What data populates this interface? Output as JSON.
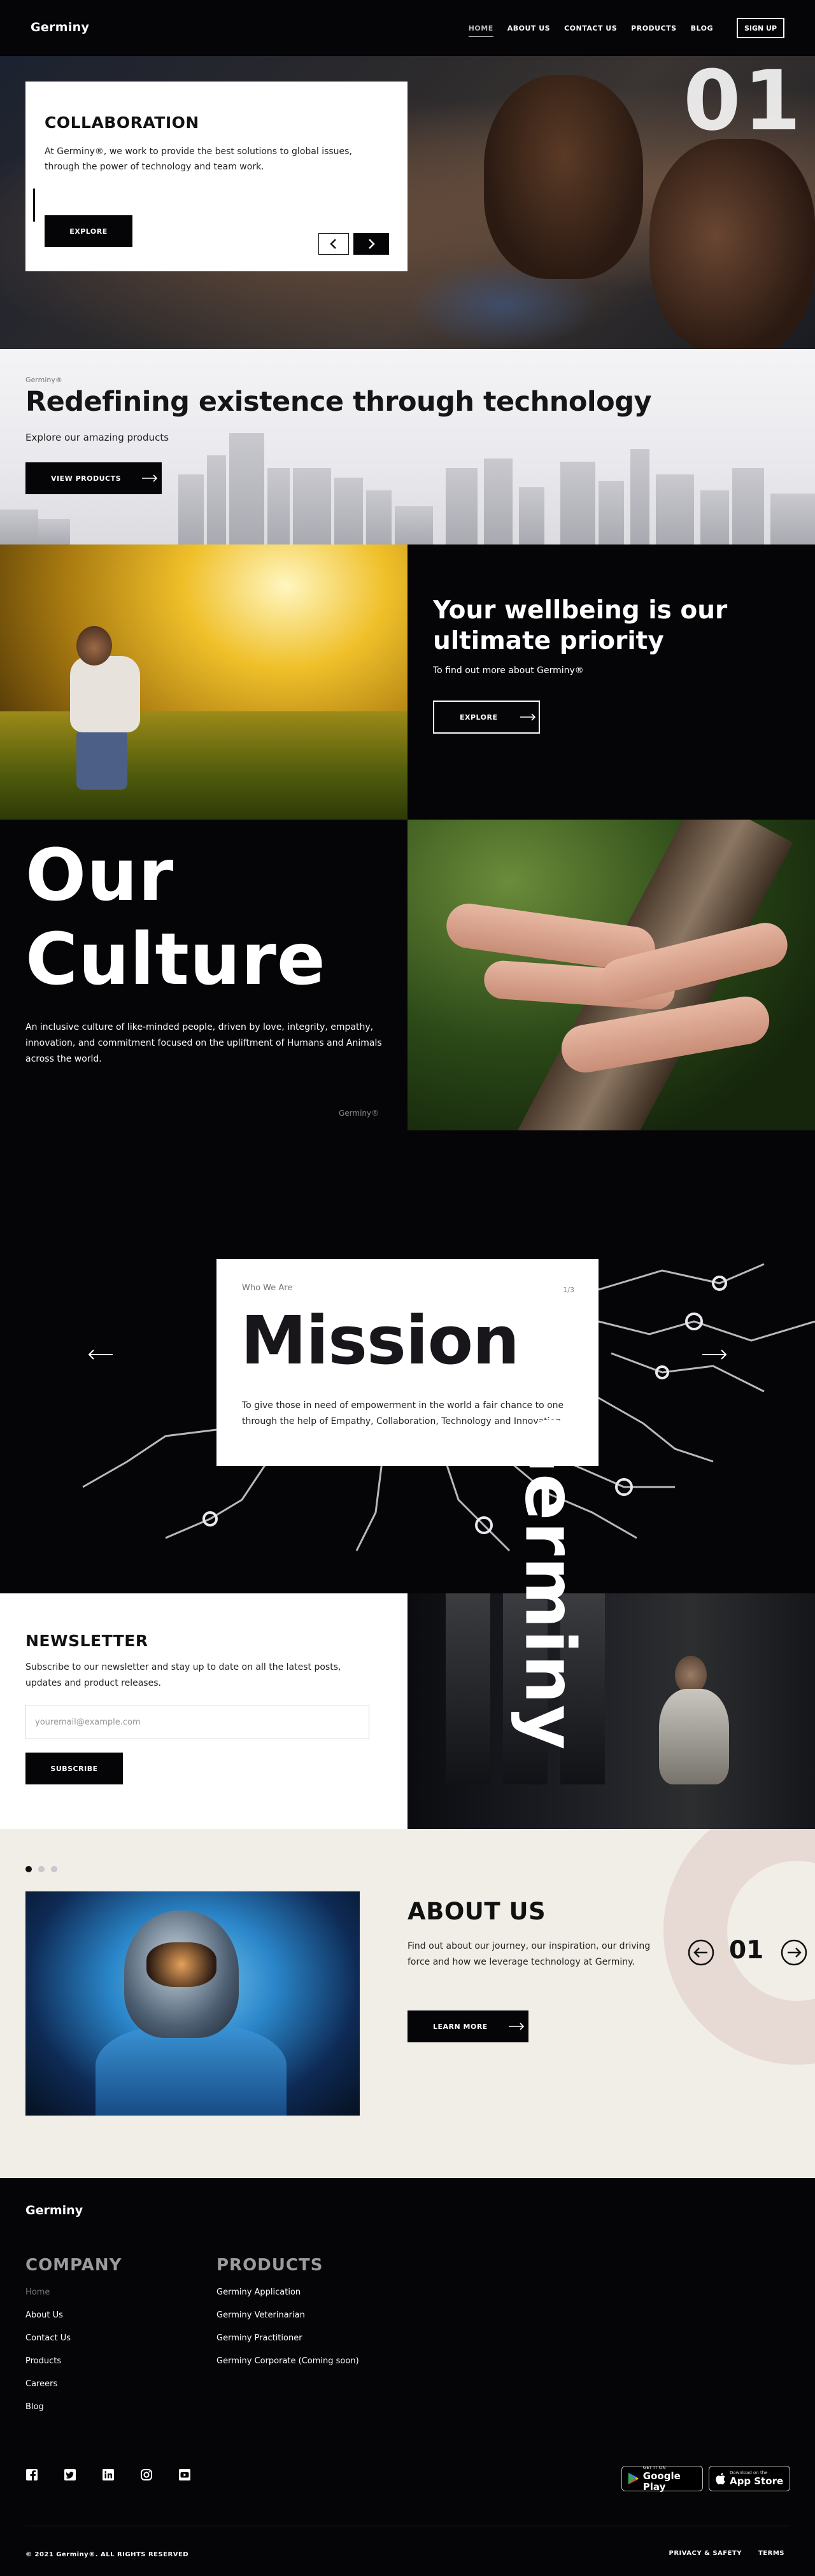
{
  "nav": {
    "logo": "Germiny",
    "items": [
      "HOME",
      "ABOUT US",
      "CONTACT US",
      "PRODUCTS",
      "BLOG"
    ],
    "signup": "SIGN UP"
  },
  "hero": {
    "slide_number": "01",
    "title": "COLLABORATION",
    "text": "At Germiny®, we work to provide the best solutions to global issues, through the power of technology and team work.",
    "button": "EXPLORE"
  },
  "redefining": {
    "tag": "Germiny®",
    "title": "Redefining existence through technology",
    "subtitle": "Explore our amazing products",
    "button": "VIEW PRODUCTS"
  },
  "wellbeing": {
    "title": "Your wellbeing is our ultimate priority",
    "subtitle": "To find out more about Germiny®",
    "button": "EXPLORE"
  },
  "culture": {
    "title_line1": "Our",
    "title_line2": "Culture",
    "text": "An inclusive culture of like-minded people, driven by love, integrity, empathy, innovation, and commitment focused on the upliftment of Humans and Animals across the world.",
    "brand": "Germiny®"
  },
  "mission": {
    "eyebrow": "Who We Are",
    "counter": "1/3",
    "title": "Mission",
    "text": "To give those in need of empowerment in the world a fair chance to one through the help of Empathy, Collaboration, Technology and Innovation."
  },
  "newsletter": {
    "title": "NEWSLETTER",
    "text": "Subscribe to our newsletter and stay up to date on all the latest posts, updates and product releases.",
    "placeholder": "youremail@example.com",
    "button": "SUBSCRIBE",
    "brand_vertical": "Germiny"
  },
  "about": {
    "title": "ABOUT US",
    "text": "Find out about our journey, our inspiration, our driving force and how we leverage technology at Germiny.",
    "button": "LEARN MORE",
    "slide_number": "01",
    "dots_total": 3,
    "dots_active": 1
  },
  "footer": {
    "logo": "Germiny",
    "company_heading": "COMPANY",
    "company_links": [
      "Home",
      "About Us",
      "Contact Us",
      "Products",
      "Careers",
      "Blog"
    ],
    "products_heading": "PRODUCTS",
    "product_links": [
      "Germiny Application",
      "Germiny Veterinarian",
      "Germiny Practitioner",
      "Germiny Corporate (Coming soon)"
    ],
    "social_icons": [
      "facebook-icon",
      "twitter-icon",
      "linkedin-icon",
      "instagram-icon",
      "youtube-icon"
    ],
    "google_play": {
      "line1": "GET IT ON",
      "line2": "Google Play"
    },
    "app_store": {
      "line1": "Download on the",
      "line2": "App Store"
    },
    "copyright": "© 2021 Germiny®. ALL RIGHTS RESERVED",
    "privacy": "PRIVACY & SAFETY",
    "terms": "TERMS"
  },
  "colors": {
    "dark": "#050406",
    "light": "#ffffff",
    "about_bg": "#f1eee7",
    "ring": "#e7d9d4"
  }
}
